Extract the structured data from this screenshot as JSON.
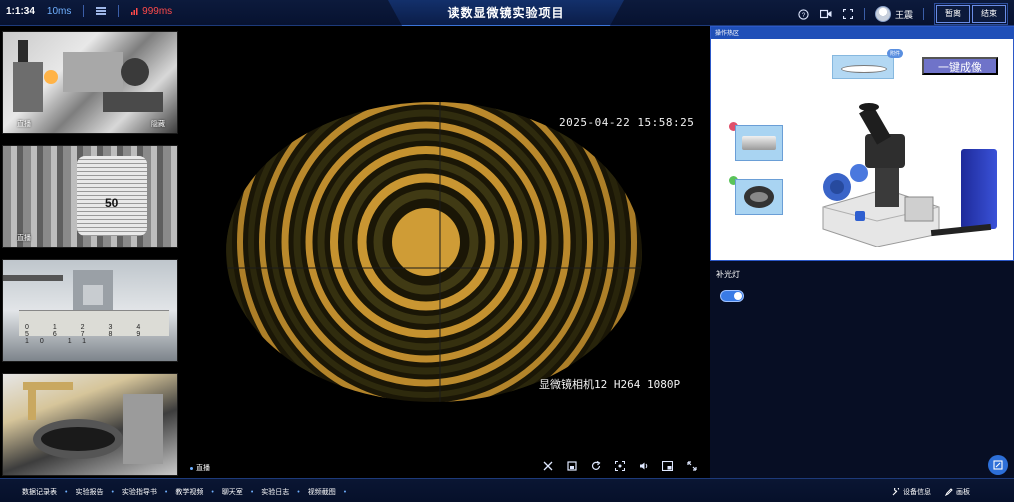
{
  "header": {
    "timer": "1:1:34",
    "latency": "10ms",
    "signal": "999ms",
    "title": "读数显微镜实验项目",
    "username": "王震",
    "buttons": [
      "暂离",
      "结束"
    ]
  },
  "thumbnails": [
    {
      "left_label": "直播",
      "right_label": "隐藏"
    },
    {
      "left_label": "直播",
      "right_label": "",
      "dial_number": "50"
    },
    {
      "left_label": "",
      "right_label": "",
      "ruler_numbers": "0 1 2 3 4 5 6 7 8 9 10 11"
    },
    {
      "left_label": "",
      "right_label": ""
    }
  ],
  "video": {
    "timestamp": "2025-04-22  15:58:25",
    "camera_label": "显微镜相机12 H264 1080P",
    "live_label": "直播"
  },
  "ops_panel": {
    "title": "操作热区",
    "lens_tag": "附件",
    "one_key_button": "一键成像"
  },
  "fill_light": {
    "label": "补光灯",
    "on": true
  },
  "bottom_links": [
    "数据记录表",
    "实验报告",
    "实验指导书",
    "教学视频",
    "聊天室",
    "实验日志",
    "视频截图"
  ],
  "bottom_right": {
    "device_info": "设备信息",
    "sketchpad": "画板"
  },
  "colors": {
    "accent": "#2d6fd8",
    "header_bg": "#0c1a3c",
    "fringe_bright": "#d9a53a",
    "fringe_dark": "#3f3a14"
  }
}
